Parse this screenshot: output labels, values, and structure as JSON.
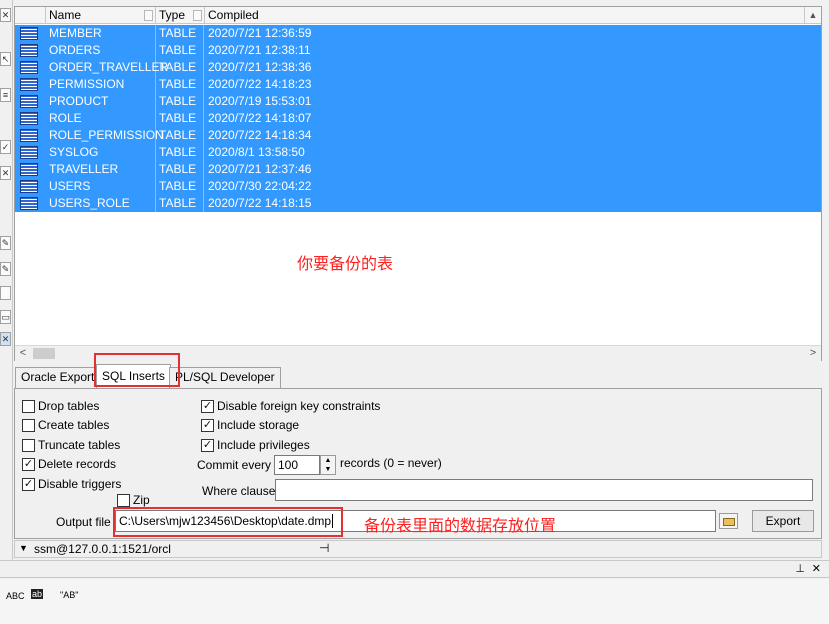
{
  "grid": {
    "columns": [
      "Name",
      "Type",
      "Compiled"
    ],
    "rows": [
      {
        "name": "MEMBER",
        "type": "TABLE",
        "compiled": "2020/7/21 12:36:59"
      },
      {
        "name": "ORDERS",
        "type": "TABLE",
        "compiled": "2020/7/21 12:38:11"
      },
      {
        "name": "ORDER_TRAVELLER",
        "type": "TABLE",
        "compiled": "2020/7/21 12:38:36"
      },
      {
        "name": "PERMISSION",
        "type": "TABLE",
        "compiled": "2020/7/22 14:18:23"
      },
      {
        "name": "PRODUCT",
        "type": "TABLE",
        "compiled": "2020/7/19 15:53:01"
      },
      {
        "name": "ROLE",
        "type": "TABLE",
        "compiled": "2020/7/22 14:18:07"
      },
      {
        "name": "ROLE_PERMISSION",
        "type": "TABLE",
        "compiled": "2020/7/22 14:18:34"
      },
      {
        "name": "SYSLOG",
        "type": "TABLE",
        "compiled": "2020/8/1 13:58:50"
      },
      {
        "name": "TRAVELLER",
        "type": "TABLE",
        "compiled": "2020/7/21 12:37:46"
      },
      {
        "name": "USERS",
        "type": "TABLE",
        "compiled": "2020/7/30 22:04:22"
      },
      {
        "name": "USERS_ROLE",
        "type": "TABLE",
        "compiled": "2020/7/22 14:18:15"
      }
    ]
  },
  "annotations": {
    "tables_note": "你要备份的表",
    "output_note": "备份表里面的数据存放位置"
  },
  "tabs": [
    "Oracle Export",
    "SQL Inserts",
    "PL/SQL Developer"
  ],
  "active_tab": "SQL Inserts",
  "options": {
    "left": [
      {
        "label": "Drop tables",
        "checked": false
      },
      {
        "label": "Create tables",
        "checked": false
      },
      {
        "label": "Truncate tables",
        "checked": false
      },
      {
        "label": "Delete records",
        "checked": true
      },
      {
        "label": "Disable triggers",
        "checked": true
      }
    ],
    "right": [
      {
        "label": "Disable foreign key constraints",
        "checked": true
      },
      {
        "label": "Include storage",
        "checked": true
      },
      {
        "label": "Include privileges",
        "checked": true
      }
    ],
    "zip": {
      "label": "Zip",
      "checked": false
    },
    "commit_every_label": "Commit every",
    "commit_every_value": "100",
    "records_note": "records (0 = never)",
    "where_clause_label": "Where clause",
    "where_clause_value": "",
    "output_file_label": "Output file",
    "output_file_value": "C:\\Users\\mjw123456\\Desktop\\date.dmp",
    "export_label": "Export"
  },
  "status": {
    "connection": "ssm@127.0.0.1:1521/orcl"
  },
  "bottom_bar": {
    "icons": [
      "ABC",
      "ab",
      "\"AB\""
    ]
  },
  "colors": {
    "selection": "#3399ff",
    "annotation": "#ff2020"
  }
}
